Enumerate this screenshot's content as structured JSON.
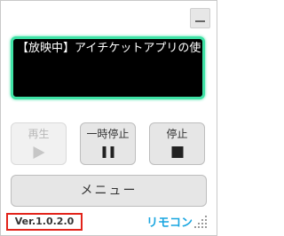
{
  "window": {
    "minimize_label": ""
  },
  "screen": {
    "now_showing": "【放映中】アイチケットアプリの使い方"
  },
  "controls": {
    "play": {
      "label": "再生",
      "icon": "play-icon",
      "enabled": false
    },
    "pause": {
      "label": "一時停止",
      "icon": "pause-icon",
      "enabled": true
    },
    "stop": {
      "label": "停止",
      "icon": "stop-icon",
      "enabled": true
    }
  },
  "menu": {
    "label": "メニュー"
  },
  "footer": {
    "version": "Ver.1.0.2.0",
    "brand": "リモコン",
    "resize_icon": "resize-grip-icon"
  },
  "colors": {
    "screen_border": "#3fe2a6",
    "version_border": "#e2231a",
    "brand": "#1aa6e0"
  }
}
